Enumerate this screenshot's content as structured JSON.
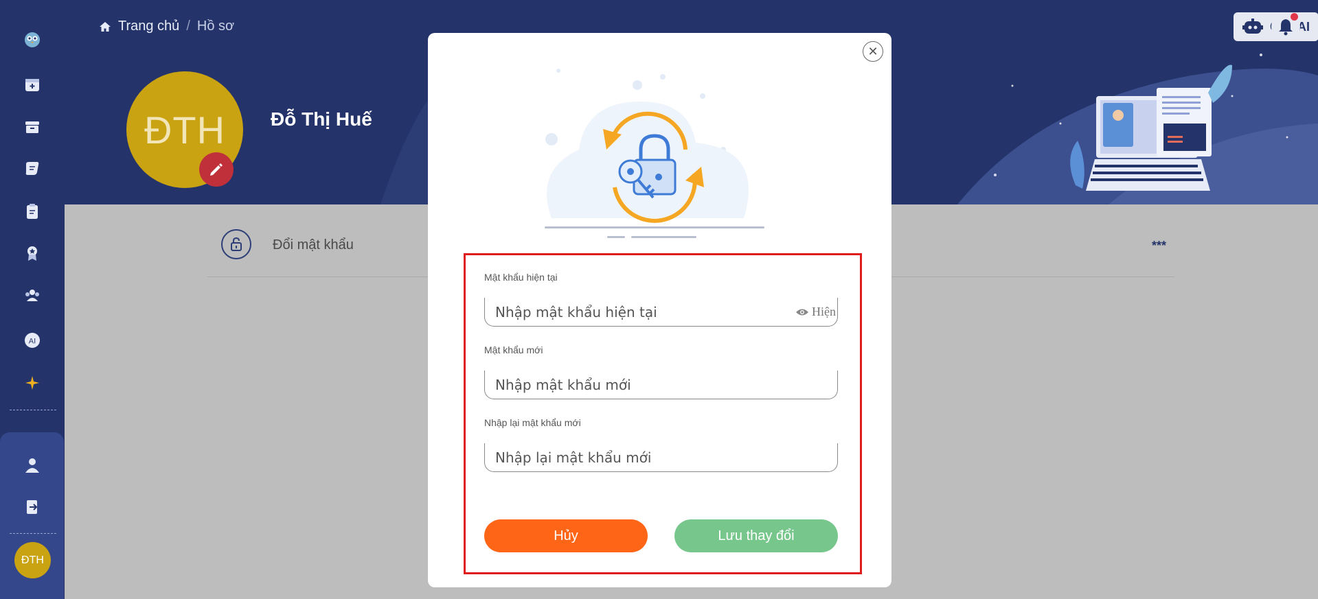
{
  "breadcrumb": {
    "home": "Trang chủ",
    "separator": "/",
    "current": "Hồ sơ"
  },
  "profile": {
    "initials": "ĐTH",
    "name": "Đỗ Thị Huế"
  },
  "topbar": {
    "chatai_label": "ChatAI"
  },
  "sidebar": {
    "avatar_initials": "ĐTH",
    "items": [
      "logo-icon",
      "calendar-add-icon",
      "archive-icon",
      "chat-icon",
      "clipboard-icon",
      "award-icon",
      "group-icon",
      "ai-icon",
      "sparkle-icon",
      "user-icon",
      "logout-icon"
    ]
  },
  "settings_row": {
    "label": "Đổi mật khẩu",
    "value": "***"
  },
  "modal": {
    "current_label": "Mật khẩu hiện tại",
    "current_placeholder": "Nhập mật khẩu hiện tại",
    "show_label": "Hiện",
    "new_label": "Mật khẩu mới",
    "new_placeholder": "Nhập mật khẩu mới",
    "confirm_label": "Nhập lại mật khẩu mới",
    "confirm_placeholder": "Nhập lại mật khẩu mới",
    "cancel_label": "Hủy",
    "save_label": "Lưu thay đổi"
  },
  "colors": {
    "sidebar_bg": "#24346a",
    "cancel": "#ff6516",
    "save": "#77c78d",
    "highlight": "#e01b1b",
    "avatar": "#c9a312"
  }
}
